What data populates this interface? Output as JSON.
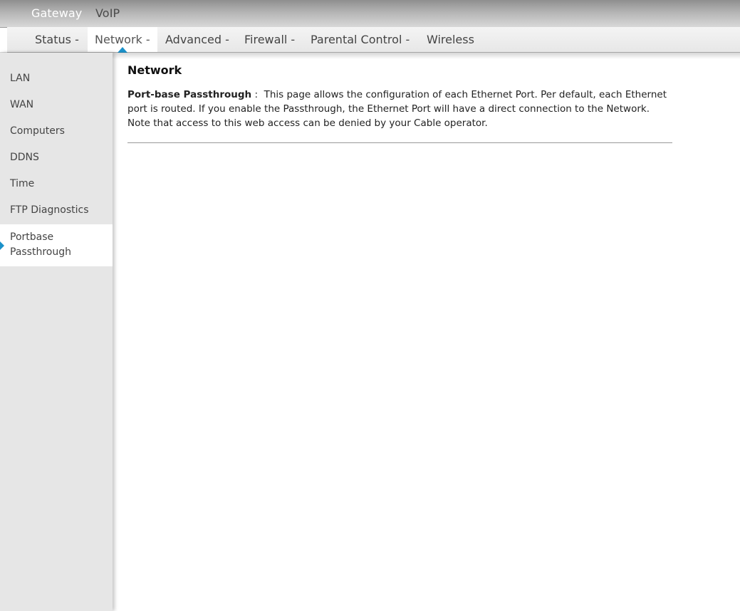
{
  "top_tabs": [
    {
      "label": "Gateway",
      "active": true
    },
    {
      "label": "VoIP",
      "active": false
    }
  ],
  "nav": {
    "items": [
      {
        "label": "Status -",
        "active": false
      },
      {
        "label": "Network -",
        "active": true
      },
      {
        "label": "Advanced -",
        "active": false
      },
      {
        "label": "Firewall -",
        "active": false
      },
      {
        "label": "Parental Control -",
        "active": false
      },
      {
        "label": "Wireless",
        "active": false
      }
    ]
  },
  "sidebar": {
    "items": [
      {
        "label": "LAN",
        "active": false
      },
      {
        "label": "WAN",
        "active": false
      },
      {
        "label": "Computers",
        "active": false
      },
      {
        "label": "DDNS",
        "active": false
      },
      {
        "label": "Time",
        "active": false
      },
      {
        "label": "FTP Diagnostics",
        "active": false
      },
      {
        "label": "Portbase Passthrough",
        "active": true
      }
    ]
  },
  "main": {
    "title": "Network",
    "description_term": "Port-base Passthrough",
    "description_separator": " :  ",
    "description_text": "This page allows the configuration of each Ethernet Port. Per default, each Ethernet port is routed. If you enable the Passthrough, the Ethernet Port will have a direct connection to the Network. Note that access to this web access can be denied by your Cable operator."
  },
  "colors": {
    "accent": "#1b91c9",
    "sidebar_bg": "#e6e6e6",
    "topbar_bg": "#a8a8a8"
  }
}
